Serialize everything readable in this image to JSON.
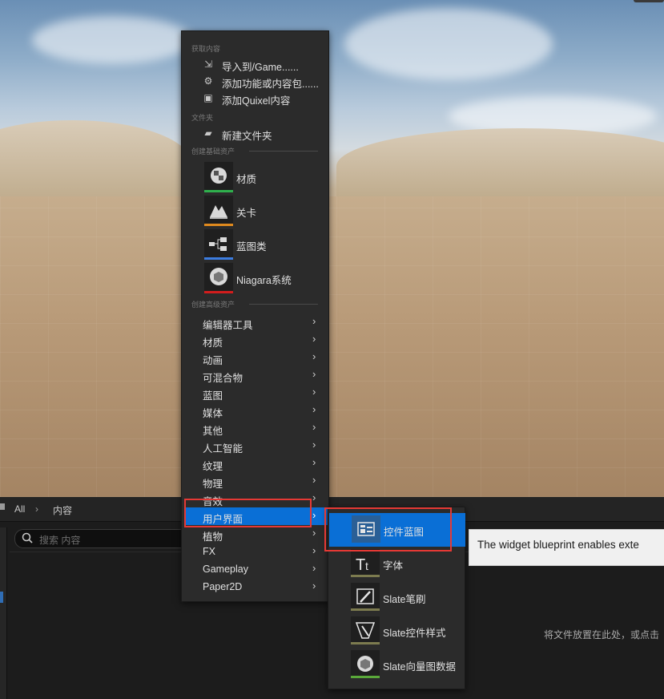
{
  "menu": {
    "sections": {
      "get_content": "获取内容",
      "folder": "文件夹",
      "basic_assets": "创建基础资产",
      "advanced_assets": "创建高级资产"
    },
    "get_content_items": [
      {
        "label": "导入到/Game......",
        "icon": "import-icon"
      },
      {
        "label": "添加功能或内容包......",
        "icon": "add-feature-pack-icon"
      },
      {
        "label": "添加Quixel内容",
        "icon": "quixel-icon"
      }
    ],
    "folder_items": [
      {
        "label": "新建文件夹",
        "icon": "new-folder-icon"
      }
    ],
    "basic_items": [
      {
        "label": "材质",
        "icon": "material-icon",
        "color": "#2fb04d"
      },
      {
        "label": "关卡",
        "icon": "level-icon",
        "color": "#e08a1e"
      },
      {
        "label": "蓝图类",
        "icon": "blueprint-class-icon",
        "color": "#3c7de0"
      },
      {
        "label": "Niagara系统",
        "icon": "niagara-system-icon",
        "color": "#d21d1d"
      }
    ],
    "advanced_items": [
      {
        "label": "编辑器工具"
      },
      {
        "label": "材质"
      },
      {
        "label": "动画"
      },
      {
        "label": "可混合物"
      },
      {
        "label": "蓝图"
      },
      {
        "label": "媒体"
      },
      {
        "label": "其他"
      },
      {
        "label": "人工智能"
      },
      {
        "label": "纹理"
      },
      {
        "label": "物理"
      },
      {
        "label": "音效"
      },
      {
        "label": "用户界面",
        "active": true
      },
      {
        "label": "植物"
      },
      {
        "label": "FX"
      },
      {
        "label": "Gameplay"
      },
      {
        "label": "Paper2D"
      }
    ]
  },
  "submenu": {
    "items": [
      {
        "label": "控件蓝图",
        "icon": "widget-blueprint-icon",
        "active": true
      },
      {
        "label": "字体",
        "icon": "font-icon"
      },
      {
        "label": "Slate笔刷",
        "icon": "slate-brush-icon"
      },
      {
        "label": "Slate控件样式",
        "icon": "slate-widget-style-icon"
      },
      {
        "label": "Slate向量图数据",
        "icon": "slate-vector-art-icon"
      }
    ]
  },
  "tooltip": {
    "text": "The widget blueprint enables exte"
  },
  "content_browser": {
    "breadcrumb_all": "All",
    "breadcrumb_content": "内容",
    "search_placeholder": "搜索 内容",
    "drop_hint": "将文件放置在此处，或点击"
  },
  "colors": {
    "accent": "#0a6fd6",
    "highlight": "#e53935",
    "menu_bg": "#2b2b2b"
  }
}
